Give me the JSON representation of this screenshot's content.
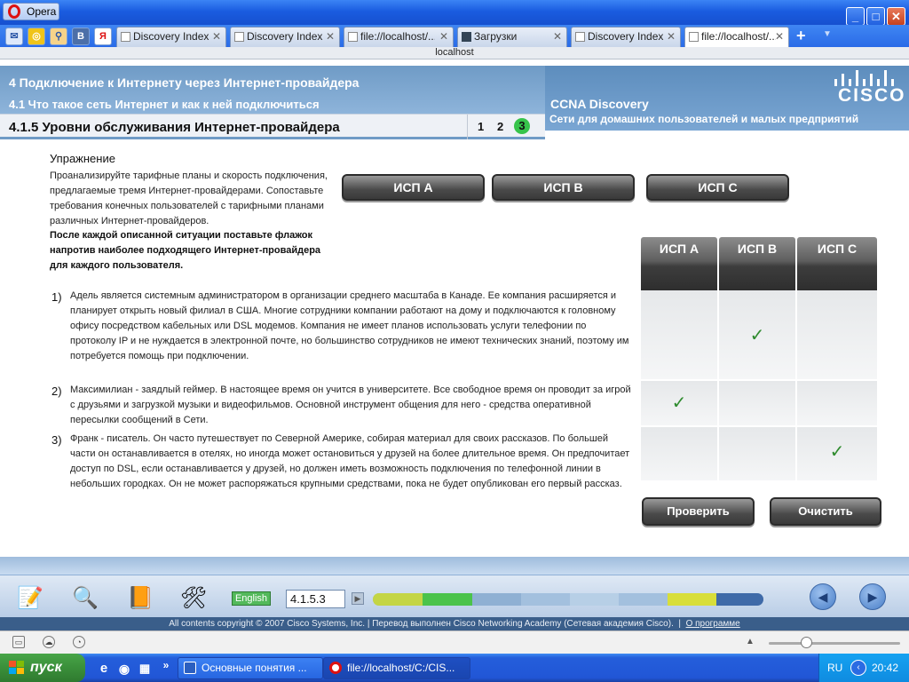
{
  "browser": {
    "app_label": "Opera",
    "address": "localhost",
    "quick_icons": [
      "mail-icon",
      "opera-link-icon",
      "search-icon",
      "vk-icon",
      "yandex-icon"
    ],
    "tabs": [
      {
        "label": "Discovery Index",
        "active": false
      },
      {
        "label": "Discovery Index",
        "active": false
      },
      {
        "label": "file://localhost/...",
        "active": false
      },
      {
        "label": "Загрузки",
        "active": false
      },
      {
        "label": "Discovery Index",
        "active": false
      },
      {
        "label": "file://localhost/...",
        "active": true
      }
    ],
    "more_tabs": "»"
  },
  "header": {
    "chapter": "4 Подключение к Интернету через Интернет-провайдера",
    "section": "4.1 Что такое сеть Интернет и как к ней подключиться",
    "topic": "4.1.5 Уровни обслуживания Интернет-провайдера",
    "pages": [
      "1",
      "2",
      "3"
    ],
    "current_page": "3",
    "brand": "CISCO",
    "course": "CCNA Discovery",
    "course_sub": "Сети для домашних пользователей и малых предприятий"
  },
  "exercise": {
    "title": "Упражнение",
    "description": "Проанализируйте тарифные планы и скорость подключения, предлагаемые тремя Интернет-провайдерами. Сопоставьте требования конечных пользователей с тарифными планами различных Интернет-провайдеров.",
    "instruction": "После каждой описанной ситуации поставьте флажок напротив наиболее подходящего Интернет-провайдера для каждого пользователя.",
    "isp_buttons": [
      "ИСП A",
      "ИСП B",
      "ИСП C"
    ],
    "grid_headers": [
      "ИСП A",
      "ИСП B",
      "ИСП C"
    ],
    "check_mark": "✓",
    "situations": [
      {
        "num": "1)",
        "text": "Адель является системным администратором в организации среднего масштаба в Канаде. Ее компания расширяется и планирует открыть новый филиал в США. Многие сотрудники компании работают на дому и подключаются к головному офису посредством кабельных или DSL модемов. Компания не имеет планов использовать услуги телефонии по протоколу IP и не нуждается в электронной почте, но большинство сотрудников не имеют технических знаний, поэтому им потребуется помощь при подключении.",
        "checked": 1
      },
      {
        "num": "2)",
        "text": "Максимилиан - заядлый геймер. В настоящее время он учится в университете. Все свободное время он проводит за игрой с друзьями и загрузкой музыки и видеофильмов. Основной инструмент общения для него - средства оперативной пересылки сообщений в Сети.",
        "checked": 0
      },
      {
        "num": "3)",
        "text": "Франк - писатель. Он часто путешествует по Северной Америке, собирая материал для своих рассказов. По большей части он останавливается в отелях, но иногда может остановиться у друзей на более длительное время. Он предпочитает доступ по DSL, если останавливается у друзей, но должен иметь возможность подключения по телефонной линии в небольших городках. Он не может распоряжаться крупными средствами, пока не будет опубликован его первый рассказ.",
        "checked": 2
      }
    ],
    "check_button": "Проверить",
    "clear_button": "Очистить"
  },
  "toolbar": {
    "language": "English",
    "page_number": "4.1.5.3",
    "copyright": "All contents copyright © 2007 Cisco Systems, Inc. | Перевод выполнен Cisco Networking Academy (Сетевая академия Cisco).",
    "about_link": "О программе"
  },
  "taskbar": {
    "start": "пуск",
    "apps": [
      {
        "label": "Основные понятия ...",
        "active": false
      },
      {
        "label": "file://localhost/C:/CIS...",
        "active": true
      }
    ],
    "lang": "RU",
    "clock": "20:42"
  }
}
